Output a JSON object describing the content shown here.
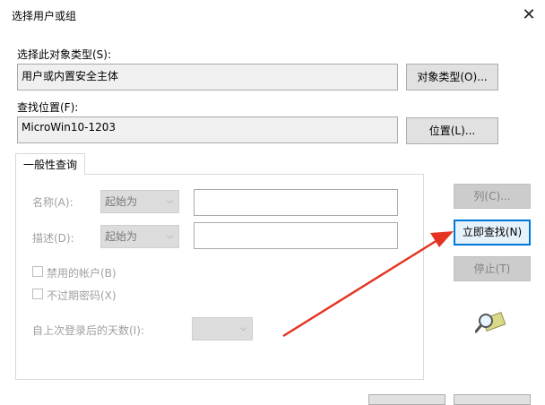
{
  "window": {
    "title": "选择用户或组"
  },
  "object_type": {
    "label": "选择此对象类型(S):",
    "value": "用户或内置安全主体",
    "button": "对象类型(O)..."
  },
  "location": {
    "label": "查找位置(F):",
    "value": "MicroWin10-1203",
    "button": "位置(L)..."
  },
  "query": {
    "tab": "一般性查询",
    "name_label": "名称(A):",
    "name_mode": "起始为",
    "desc_label": "描述(D):",
    "desc_mode": "起始为",
    "disabled_accounts": "禁用的帐户(B)",
    "non_expiring_pw": "不过期密码(X)",
    "days_since_login": "自上次登录后的天数(I):"
  },
  "side_buttons": {
    "columns": "列(C)...",
    "find_now": "立即查找(N)",
    "stop": "停止(T)"
  },
  "icons": {
    "search_graphic": "search-magnifier-icon",
    "close": "close-icon",
    "chevron": "chevron-down-icon"
  },
  "colors": {
    "annotation_arrow": "#e53322",
    "focus_border": "#0078d7"
  }
}
